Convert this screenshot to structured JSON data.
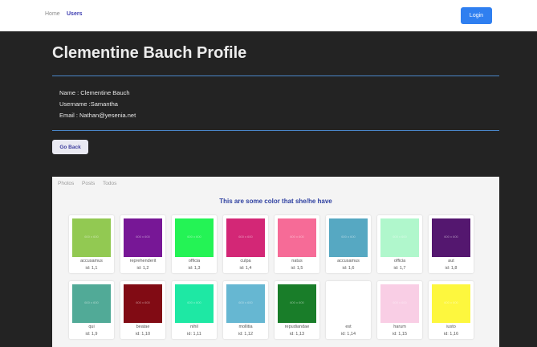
{
  "nav": {
    "home": "Home",
    "users": "Users",
    "login": "Login"
  },
  "profile": {
    "title": "Clementine Bauch Profile",
    "name_line": "Name : Clementine Bauch",
    "username_line": "Username :Samantha",
    "email_line": "Email : Nathan@yesenia.net",
    "back_label": "Go Back"
  },
  "tabs": [
    "Photos",
    "Posts",
    "Todos"
  ],
  "gallery": {
    "heading": "This are some color that she/he have",
    "items": [
      {
        "title": "accusamus",
        "id": "id: 1,1",
        "color": "#92c952",
        "size": "600 x 600"
      },
      {
        "title": "reprehenderit",
        "id": "id: 1,2",
        "color": "#771796",
        "size": "600 x 600"
      },
      {
        "title": "officia",
        "id": "id: 1,3",
        "color": "#24f355",
        "size": "600 x 600"
      },
      {
        "title": "culpa",
        "id": "id: 1,4",
        "color": "#d32776",
        "size": "600 x 600"
      },
      {
        "title": "natus",
        "id": "id: 1,5",
        "color": "#f66b97",
        "size": "600 x 600"
      },
      {
        "title": "accusamus",
        "id": "id: 1,6",
        "color": "#56a8c2",
        "size": "600 x 600"
      },
      {
        "title": "officia",
        "id": "id: 1,7",
        "color": "#b0f7cc",
        "size": "600 x 600"
      },
      {
        "title": "aut",
        "id": "id: 1,8",
        "color": "#54176f",
        "size": "600 x 600"
      },
      {
        "title": "qui",
        "id": "id: 1,9",
        "color": "#51aa97",
        "size": "600 x 600"
      },
      {
        "title": "beatae",
        "id": "id: 1,10",
        "color": "#810b14",
        "size": "600 x 600"
      },
      {
        "title": "nihil",
        "id": "id: 1,11",
        "color": "#1ee8a4",
        "size": "600 x 600"
      },
      {
        "title": "mollitia",
        "id": "id: 1,12",
        "color": "#66b7d2",
        "size": "600 x 600"
      },
      {
        "title": "repudiandae",
        "id": "id: 1,13",
        "color": "#197d29",
        "size": "600 x 600"
      },
      {
        "title": "est",
        "id": "id: 1,14",
        "color": "#61a65",
        "size": "600 x 600"
      },
      {
        "title": "harum",
        "id": "id: 1,15",
        "color": "#f9cee5",
        "size": "600 x 600"
      },
      {
        "title": "iusto",
        "id": "id: 1,16",
        "color": "#fdf73e",
        "size": "600 x 600"
      }
    ]
  }
}
